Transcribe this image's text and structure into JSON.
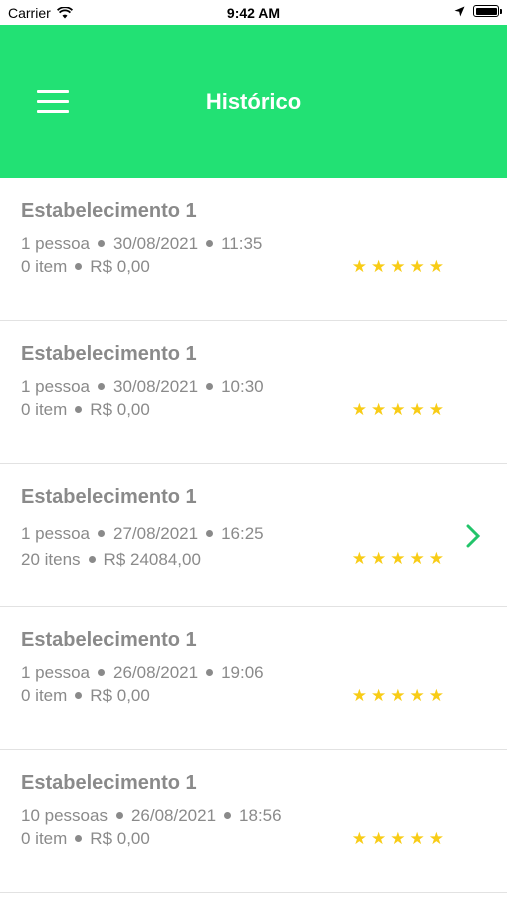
{
  "status_bar": {
    "carrier": "Carrier",
    "time": "9:42 AM"
  },
  "header": {
    "title": "Histórico"
  },
  "colors": {
    "header_bg": "#22e174",
    "star": "#f8cc16",
    "chevron": "#22c46a",
    "text": "#8a8a8a"
  },
  "rows": [
    {
      "name": "Estabelecimento 1",
      "people": "1 pessoa",
      "date": "30/08/2021",
      "time": "11:35",
      "items": "0 item",
      "total": "R$ 0,00",
      "rating": 5
    },
    {
      "name": "Estabelecimento 1",
      "people": "1 pessoa",
      "date": "30/08/2021",
      "time": "10:30",
      "items": "0 item",
      "total": "R$ 0,00",
      "rating": 5
    },
    {
      "name": "Estabelecimento 1",
      "people": "1 pessoa",
      "date": "27/08/2021",
      "time": "16:25",
      "items": "20 itens",
      "total": "R$ 24084,00",
      "rating": 5
    },
    {
      "name": "Estabelecimento 1",
      "people": "1 pessoa",
      "date": "26/08/2021",
      "time": "19:06",
      "items": "0 item",
      "total": "R$ 0,00",
      "rating": 5
    },
    {
      "name": "Estabelecimento 1",
      "people": "10 pessoas",
      "date": "26/08/2021",
      "time": "18:56",
      "items": "0 item",
      "total": "R$ 0,00",
      "rating": 5
    }
  ]
}
